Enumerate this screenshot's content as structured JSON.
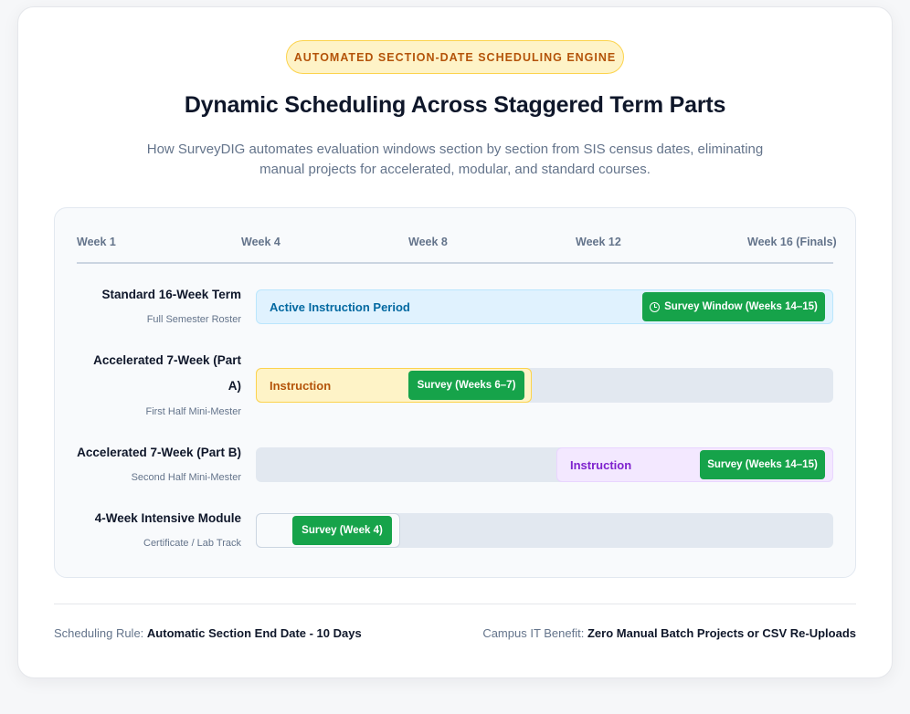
{
  "badge": "AUTOMATED SECTION-DATE SCHEDULING ENGINE",
  "title": "Dynamic Scheduling Across Staggered Term Parts",
  "subtitle": "How SurveyDIG automates evaluation windows section by section from SIS census dates, eliminating manual projects for accelerated, modular, and standard courses.",
  "axis": {
    "weeks": [
      "Week 1",
      "Week 4",
      "Week 8",
      "Week 12",
      "Week 16 (Finals)"
    ]
  },
  "rows": [
    {
      "name": "Standard 16-Week Term",
      "sub": "Full Semester Roster",
      "instruction": "Active Instruction Period",
      "survey": "Survey Window (Weeks 14–15)",
      "survey_icon": "clock-icon"
    },
    {
      "name_line1": "Accelerated 7-Week (Part",
      "name_line2": "A)",
      "sub": "First Half Mini-Mester",
      "instruction": "Instruction",
      "survey": "Survey (Weeks 6–7)"
    },
    {
      "name": "Accelerated 7-Week (Part B)",
      "sub": "Second Half Mini-Mester",
      "instruction": "Instruction",
      "survey": "Survey (Weeks 14–15)"
    },
    {
      "name": "4-Week Intensive Module",
      "sub": "Certificate / Lab Track",
      "survey": "Survey (Week 4)"
    }
  ],
  "footer": {
    "rule_label": "Scheduling Rule:",
    "rule_value": "Automatic Section End Date - 10 Days",
    "benefit_label": "Campus IT Benefit:",
    "benefit_value": "Zero Manual Batch Projects or CSV Re-Uploads"
  },
  "colors": {
    "survey": "#16a34a",
    "standard_instruction": "#e0f2fe",
    "part_a_instruction": "#fef3c7",
    "part_b_instruction": "#f3e8ff",
    "track": "#e2e8f0",
    "badge_bg": "#fef3c7",
    "badge_text": "#b45309"
  }
}
